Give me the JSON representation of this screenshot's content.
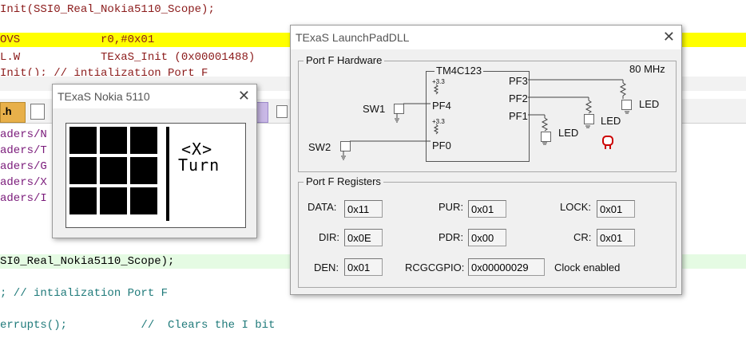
{
  "editor": {
    "lines": [
      "Init(SSI0_Real_Nokia5110_Scope);",
      "OVS            r0,#0x01",
      "L.W            TExaS_Init (0x00001488)",
      "Init(); // intialization Port F"
    ],
    "tab_file_label": ".h",
    "include_lines": [
      "aders/N",
      "aders/T",
      "aders/G",
      "aders/X",
      "aders/I"
    ],
    "green_line": "SI0_Real_Nokia5110_Scope);",
    "lower_line_1": "; // intialization Port F",
    "lower_line_2": "errupts();           //  Clears the I bit"
  },
  "nokia": {
    "title": "TExaS Nokia 5110",
    "screen_line1": "<X>",
    "screen_line2": "Turn"
  },
  "launchpad": {
    "title": "TExaS LaunchPadDLL",
    "hardware_group": "Port F Hardware",
    "chip_label": "TM4C123",
    "freq": "80 MHz",
    "sw1": "SW1",
    "sw2": "SW2",
    "pf4": "PF4",
    "pf0": "PF0",
    "pf3": "PF3",
    "pf2": "PF2",
    "pf1": "PF1",
    "v33a": "+3.3",
    "v33b": "+3.3",
    "led1": "LED",
    "led2": "LED",
    "led3": "LED",
    "registers_group": "Port F Registers",
    "registers": {
      "data_label": "DATA:",
      "data_value": "0x11",
      "pur_label": "PUR:",
      "pur_value": "0x01",
      "lock_label": "LOCK:",
      "lock_value": "0x01",
      "dir_label": "DIR:",
      "dir_value": "0x0E",
      "pdr_label": "PDR:",
      "pdr_value": "0x00",
      "cr_label": "CR:",
      "cr_value": "0x01",
      "den_label": "DEN:",
      "den_value": "0x01",
      "rcgc_label": "RCGCGPIO:",
      "rcgc_value": "0x00000029",
      "clock_status": "Clock enabled"
    }
  },
  "colors": {
    "led_red": "#cc0000",
    "highlight_yellow": "#ffff00",
    "highlight_green": "#e5fbe3"
  }
}
